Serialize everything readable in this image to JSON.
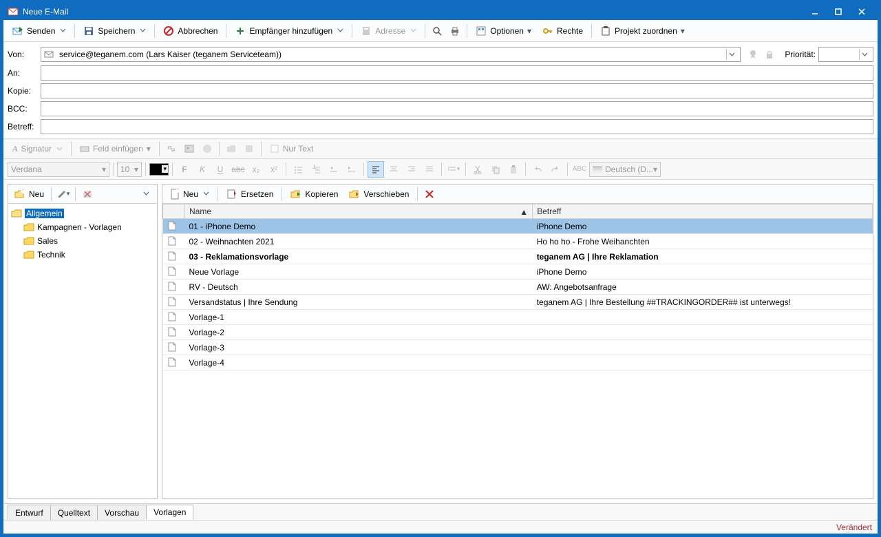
{
  "window": {
    "title": "Neue E-Mail"
  },
  "toolbar": {
    "send": "Senden",
    "save": "Speichern",
    "cancel": "Abbrechen",
    "addRecipient": "Empfänger hinzufügen",
    "address": "Adresse",
    "options": "Optionen",
    "rights": "Rechte",
    "assignProject": "Projekt zuordnen"
  },
  "fields": {
    "fromLabel": "Von:",
    "fromValue": "service@teganem.com (Lars Kaiser (teganem Serviceteam))",
    "toLabel": "An:",
    "ccLabel": "Kopie:",
    "bccLabel": "BCC:",
    "subjectLabel": "Betreff:",
    "priorityLabel": "Priorität:"
  },
  "editorToolbar": {
    "signature": "Signatur",
    "insertField": "Feld einfügen",
    "plainText": "Nur Text"
  },
  "formatToolbar": {
    "font": "Verdana",
    "size": "10",
    "language": "Deutsch (D..."
  },
  "leftPane": {
    "newBtn": "Neu",
    "tree": [
      {
        "label": "Allgemein",
        "selected": true,
        "open": true
      },
      {
        "label": "Kampagnen - Vorlagen",
        "child": true
      },
      {
        "label": "Sales",
        "child": true
      },
      {
        "label": "Technik",
        "child": true
      }
    ]
  },
  "rightPane": {
    "toolbar": {
      "new": "Neu",
      "replace": "Ersetzen",
      "copy": "Kopieren",
      "move": "Verschieben"
    },
    "columns": {
      "name": "Name",
      "subject": "Betreff"
    },
    "rows": [
      {
        "name": "01 - iPhone Demo",
        "subject": "iPhone Demo",
        "selected": true
      },
      {
        "name": "02 - Weihnachten 2021",
        "subject": "Ho ho ho - Frohe Weihanchten"
      },
      {
        "name": "03 - Reklamationsvorlage",
        "subject": "teganem AG | Ihre Reklamation",
        "bold": true
      },
      {
        "name": "Neue Vorlage",
        "subject": "iPhone Demo"
      },
      {
        "name": "RV - Deutsch",
        "subject": "AW: Angebotsanfrage"
      },
      {
        "name": "Versandstatus | Ihre Sendung",
        "subject": "teganem AG |  Ihre Bestellung ##TRACKINGORDER## ist unterwegs!"
      },
      {
        "name": "Vorlage-1",
        "subject": ""
      },
      {
        "name": "Vorlage-2",
        "subject": ""
      },
      {
        "name": "Vorlage-3",
        "subject": ""
      },
      {
        "name": "Vorlage-4",
        "subject": ""
      }
    ]
  },
  "tabs": {
    "draft": "Entwurf",
    "source": "Quelltext",
    "preview": "Vorschau",
    "templates": "Vorlagen"
  },
  "status": {
    "modified": "Verändert"
  }
}
